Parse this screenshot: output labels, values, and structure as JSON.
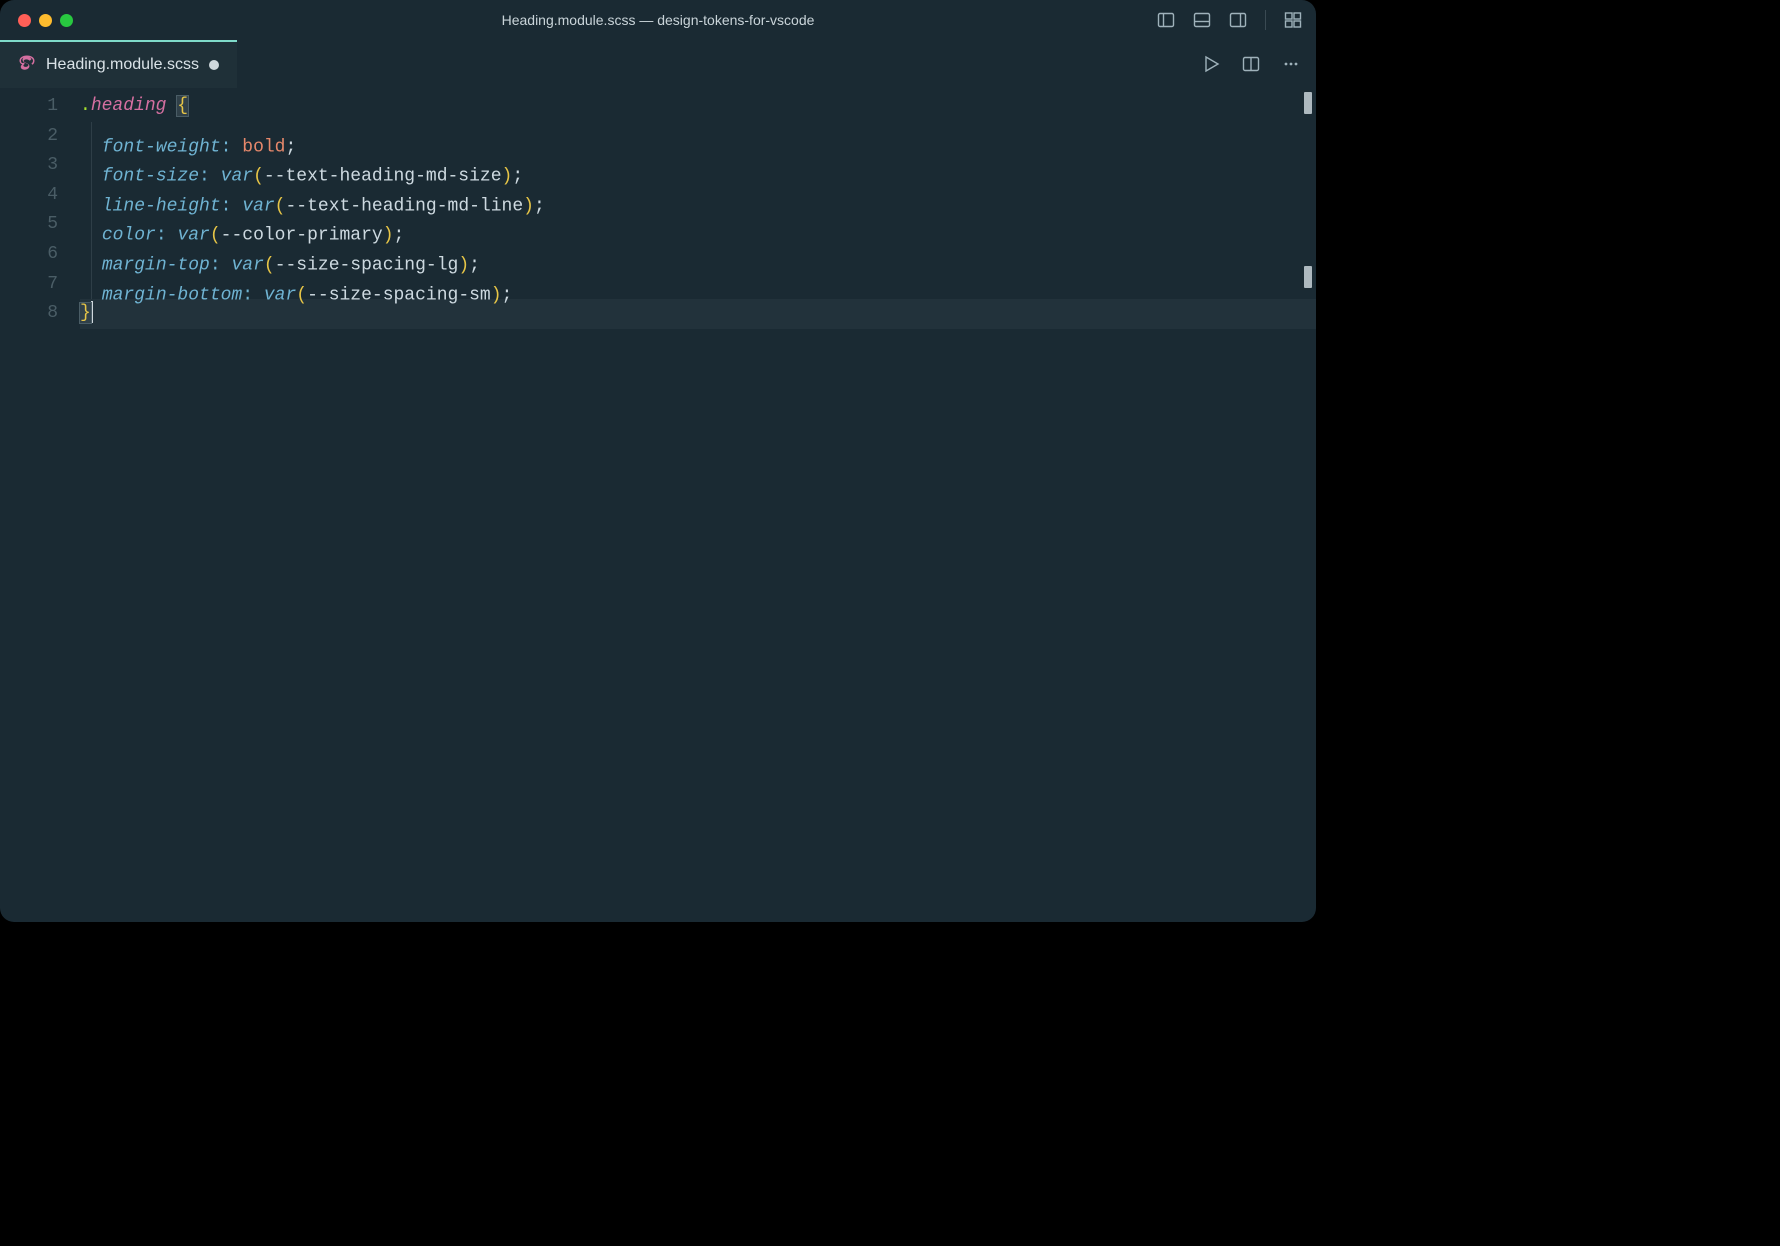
{
  "window": {
    "title": "Heading.module.scss — design-tokens-for-vscode"
  },
  "tab": {
    "label": "Heading.module.scss",
    "dirty": true
  },
  "editor": {
    "lineNumbers": [
      "1",
      "2",
      "3",
      "4",
      "5",
      "6",
      "7",
      "8"
    ],
    "currentLine": 8,
    "selectorDot": ".",
    "selectorName": "heading",
    "openBrace": "{",
    "closeBrace": "}",
    "colon": ":",
    "semi": ";",
    "openParen": "(",
    "closeParen": ")",
    "funcVar": "var",
    "lines": [
      {
        "prop": "font-weight",
        "valueText": "bold"
      },
      {
        "prop": "font-size",
        "cssvar": "--text-heading-md-size"
      },
      {
        "prop": "line-height",
        "cssvar": "--text-heading-md-line"
      },
      {
        "prop": "color",
        "cssvar": "--color-primary"
      },
      {
        "prop": "margin-top",
        "cssvar": "--size-spacing-lg"
      },
      {
        "prop": "margin-bottom",
        "cssvar": "--size-spacing-sm"
      }
    ]
  }
}
